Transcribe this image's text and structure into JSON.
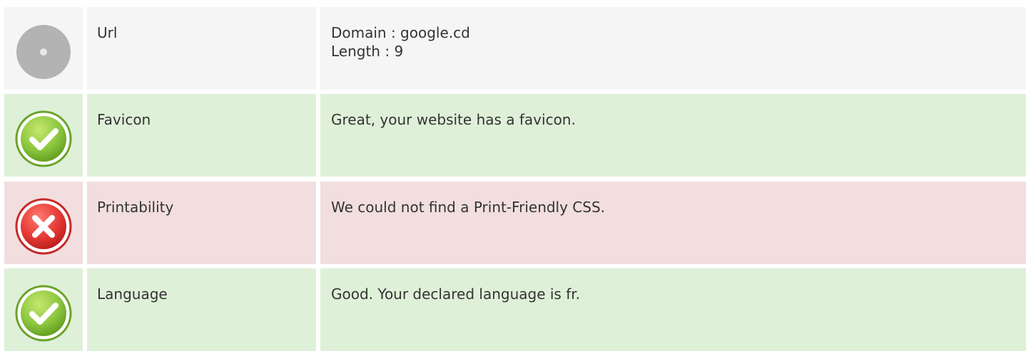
{
  "rows": [
    {
      "status": "neutral",
      "icon": "neutral-disc-icon",
      "label": "Url",
      "lines": [
        "Domain : google.cd",
        "Length : 9"
      ]
    },
    {
      "status": "good",
      "icon": "check-icon",
      "label": "Favicon",
      "lines": [
        "Great, your website has a favicon."
      ]
    },
    {
      "status": "bad",
      "icon": "error-x-icon",
      "label": "Printability",
      "lines": [
        "We could not find a Print-Friendly CSS."
      ]
    },
    {
      "status": "good",
      "icon": "check-icon",
      "label": "Language",
      "lines": [
        "Good. Your declared language is fr."
      ]
    }
  ],
  "colors": {
    "neutral_bg": "#f5f5f5",
    "good_bg": "#dff0d8",
    "bad_bg": "#f2dede",
    "good_icon": "#8cc63f",
    "bad_icon": "#e53935",
    "neutral_icon": "#b0b0b0"
  }
}
